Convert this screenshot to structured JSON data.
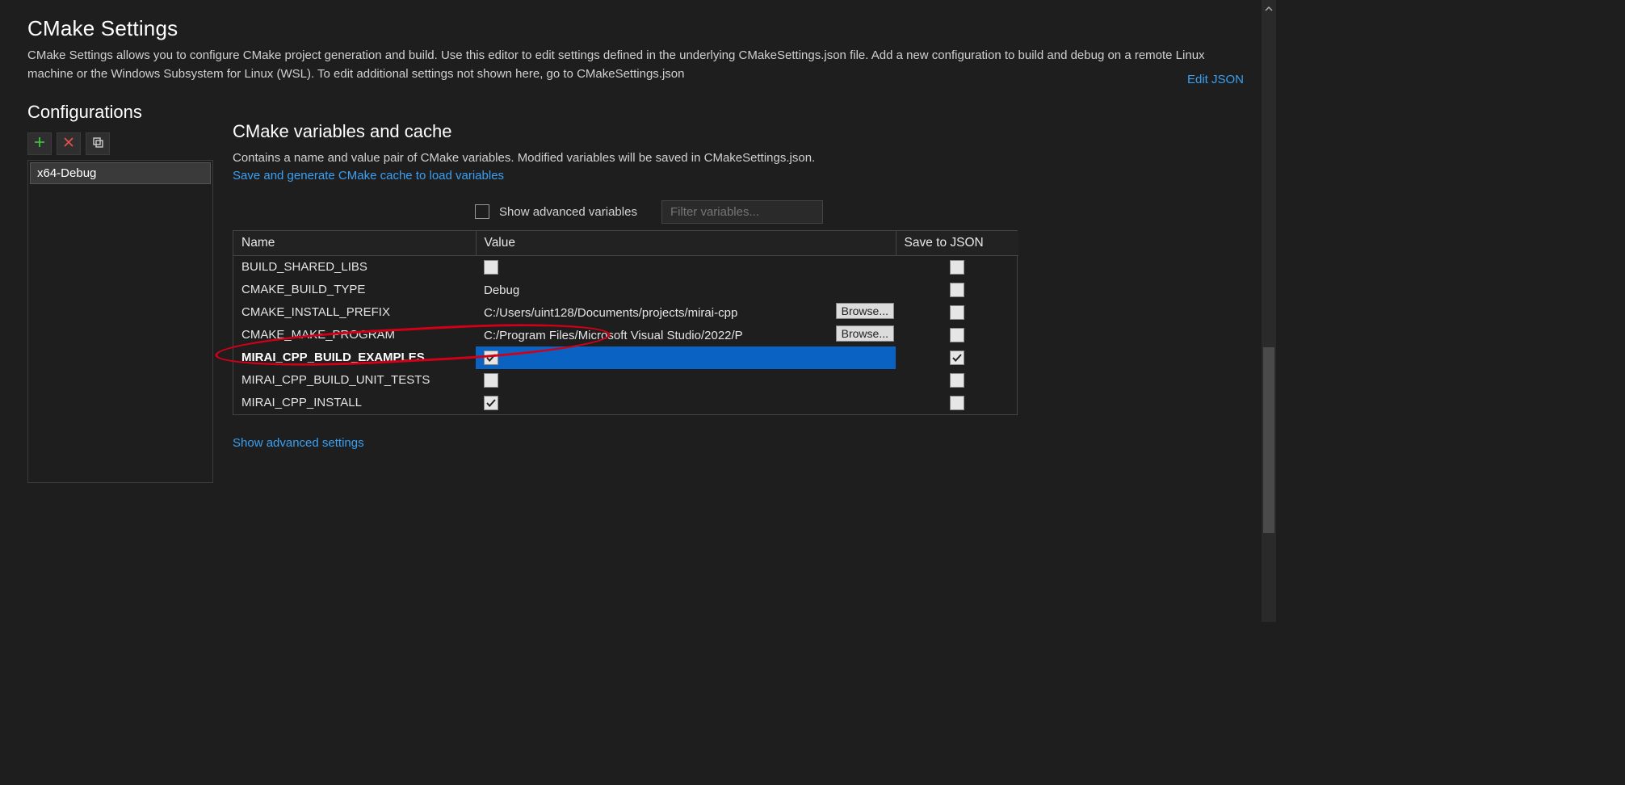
{
  "header": {
    "title": "CMake Settings",
    "description": "CMake Settings allows you to configure CMake project generation and build. Use this editor to edit settings defined in the underlying CMakeSettings.json file. Add a new configuration to build and debug on a remote Linux machine or the Windows Subsystem for Linux (WSL). To edit additional settings not shown here, go to CMakeSettings.json"
  },
  "left": {
    "title": "Configurations",
    "items": [
      "x64-Debug"
    ]
  },
  "links": {
    "edit_json": "Edit JSON",
    "save_generate": "Save and generate CMake cache to load variables",
    "show_advanced_settings": "Show advanced settings"
  },
  "section": {
    "title": "CMake variables and cache",
    "description": "Contains a name and value pair of CMake variables. Modified variables will be saved in CMakeSettings.json."
  },
  "filter": {
    "show_advanced_label": "Show advanced variables",
    "show_advanced_checked": false,
    "placeholder": "Filter variables..."
  },
  "table": {
    "columns": {
      "name": "Name",
      "value": "Value",
      "save": "Save to JSON"
    },
    "browse_label": "Browse...",
    "rows": [
      {
        "name": "BUILD_SHARED_LIBS",
        "type": "bool",
        "value": false,
        "save": false,
        "browse": false,
        "selected": false
      },
      {
        "name": "CMAKE_BUILD_TYPE",
        "type": "text",
        "value": "Debug",
        "save": false,
        "browse": false,
        "selected": false
      },
      {
        "name": "CMAKE_INSTALL_PREFIX",
        "type": "path",
        "value": "C:/Users/uint128/Documents/projects/mirai-cpp",
        "save": false,
        "browse": true,
        "selected": false
      },
      {
        "name": "CMAKE_MAKE_PROGRAM",
        "type": "path",
        "value": "C:/Program Files/Microsoft Visual Studio/2022/P",
        "save": false,
        "browse": true,
        "selected": false
      },
      {
        "name": "MIRAI_CPP_BUILD_EXAMPLES",
        "type": "bool",
        "value": true,
        "save": true,
        "browse": false,
        "selected": true
      },
      {
        "name": "MIRAI_CPP_BUILD_UNIT_TESTS",
        "type": "bool",
        "value": false,
        "save": false,
        "browse": false,
        "selected": false
      },
      {
        "name": "MIRAI_CPP_INSTALL",
        "type": "bool",
        "value": true,
        "save": false,
        "browse": false,
        "selected": false
      }
    ]
  }
}
